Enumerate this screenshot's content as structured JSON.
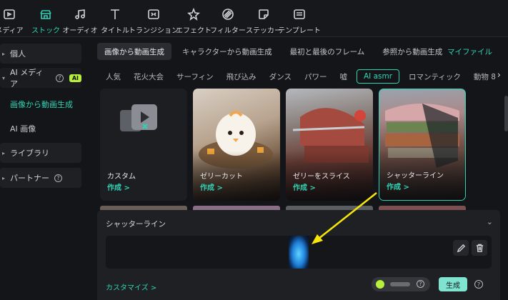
{
  "toolbar": {
    "items": [
      {
        "label": "メディア",
        "icon": "media-icon",
        "active": false
      },
      {
        "label": "ストック",
        "icon": "stock-icon",
        "active": true
      },
      {
        "label": "オーディオ",
        "icon": "music-note-icon",
        "active": false
      },
      {
        "label": "タイトル",
        "icon": "title-t-icon",
        "active": false
      },
      {
        "label": "トランジション",
        "icon": "transition-icon",
        "active": false
      },
      {
        "label": "エフェクト",
        "icon": "effect-star-icon",
        "active": false
      },
      {
        "label": "フィルター",
        "icon": "filter-icon",
        "active": false
      },
      {
        "label": "ステッカー",
        "icon": "sticker-icon",
        "active": false
      },
      {
        "label": "テンプレート",
        "icon": "template-icon",
        "active": false
      }
    ]
  },
  "sidebar": {
    "personal": "個人",
    "ai_media": "AI メディア",
    "ai_badge": "AI",
    "sub_image_to_video": "画像から動画生成",
    "sub_ai_image": "AI 画像",
    "library": "ライブラリ",
    "partner": "パートナー"
  },
  "gen_tabs": [
    "画像から動画生成",
    "キャラクターから動画生成",
    "最初と最後のフレーム",
    "参照から動画生成"
  ],
  "my_files": "マイファイル",
  "categories": [
    "人気",
    "花火大会",
    "サーフィン",
    "飛び込み",
    "ダンス",
    "パワー",
    "嘘",
    "AI asmr",
    "ロマンティック",
    "動物 8"
  ],
  "active_category": "AI asmr",
  "cards": [
    {
      "title": "カスタム",
      "cta": "作成 >",
      "selected": false
    },
    {
      "title": "ゼリーカット",
      "cta": "作成 >",
      "selected": false
    },
    {
      "title": "ゼリーをスライス",
      "cta": "作成 >",
      "selected": false
    },
    {
      "title": "シャッターライン",
      "cta": "作成 >",
      "selected": true
    }
  ],
  "panel": {
    "title": "シャッターライン",
    "customize": "カスタマイズ >",
    "generate": "生成",
    "help": "?"
  },
  "colors": {
    "accent": "#2ed3b4",
    "ai_badge": "#b7f03a",
    "arrow": "#f5e50a"
  }
}
